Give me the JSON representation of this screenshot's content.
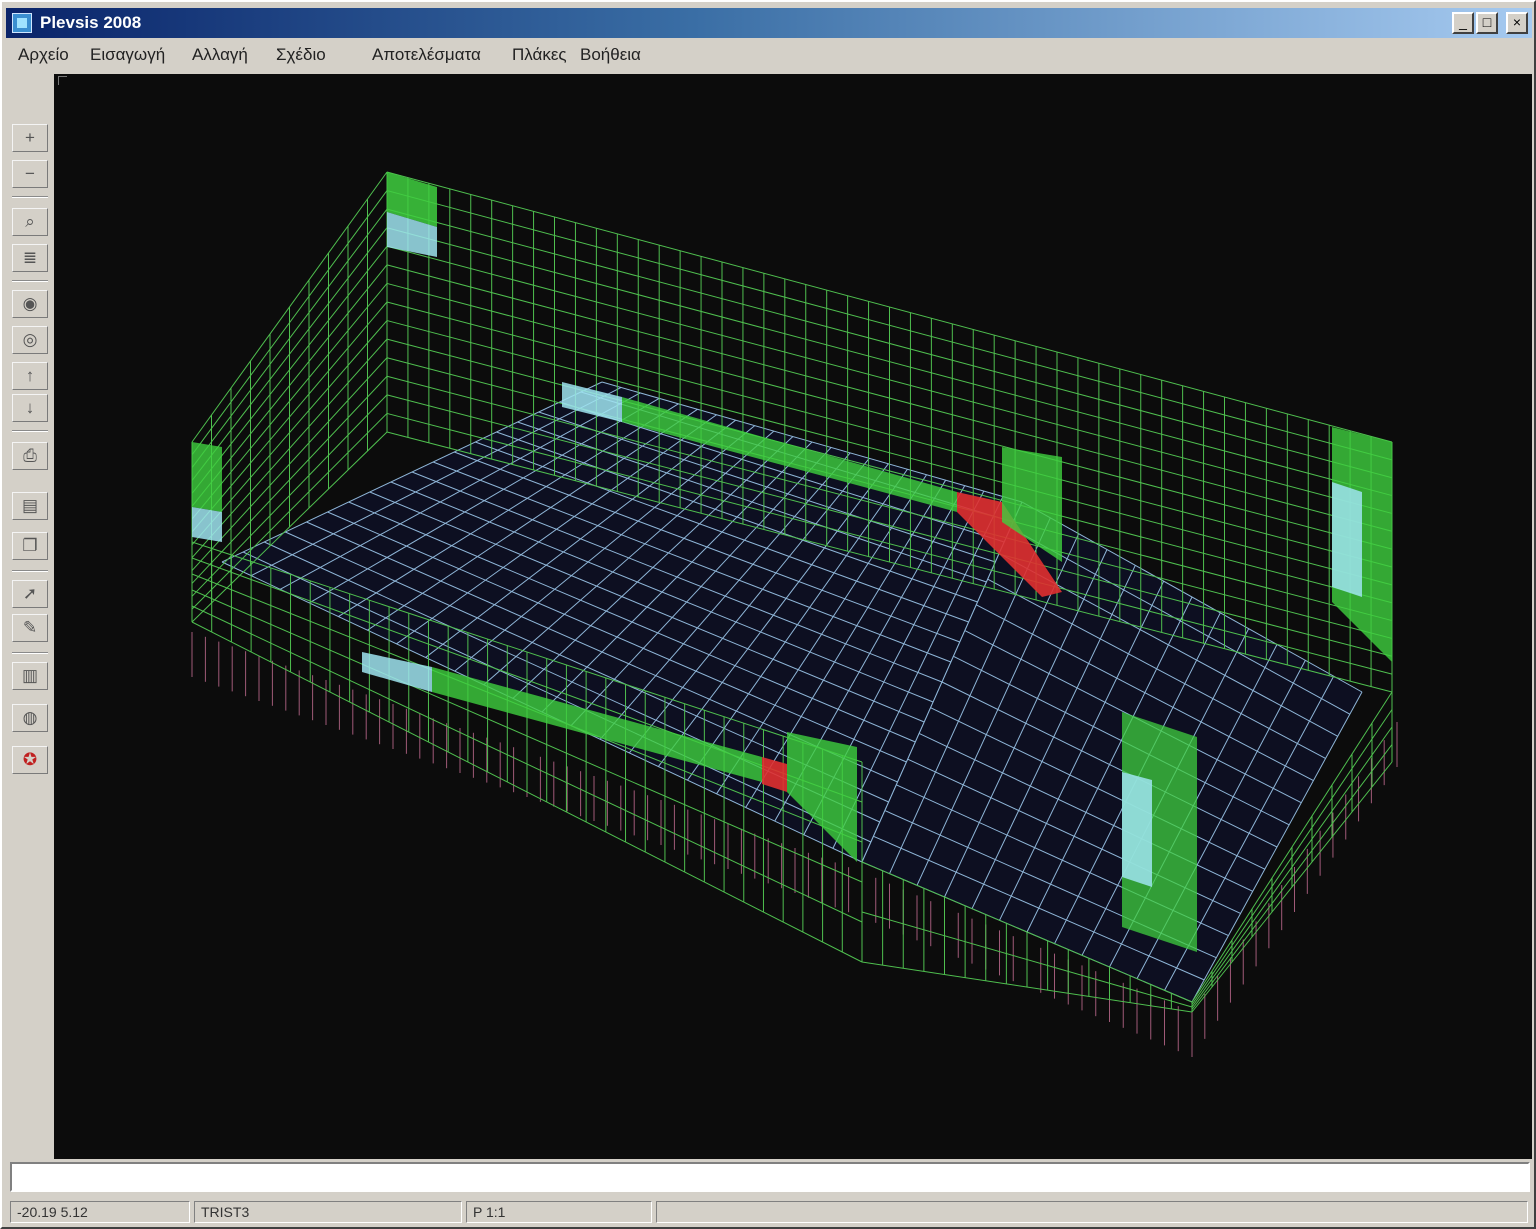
{
  "window": {
    "title": "Plevsis 2008"
  },
  "menu": [
    {
      "label": "Αρχείο"
    },
    {
      "label": "Εισαγωγή"
    },
    {
      "label": "Αλλαγή"
    },
    {
      "label": "Σχέδιο"
    },
    {
      "label": "Αποτελέσματα"
    },
    {
      "label": "Πλάκες"
    },
    {
      "label": "Βοήθεια"
    }
  ],
  "toolbar": [
    {
      "icon": "plus-icon",
      "glyph": "+"
    },
    {
      "icon": "minus-icon",
      "glyph": "−"
    },
    {
      "icon": "zoom-icon",
      "glyph": "⌕"
    },
    {
      "icon": "layers-icon",
      "glyph": "≣"
    },
    {
      "icon": "eye-icon",
      "glyph": "◉"
    },
    {
      "icon": "eye-alt-icon",
      "glyph": "◎"
    },
    {
      "icon": "move-up-icon",
      "glyph": "↑"
    },
    {
      "icon": "move-down-icon",
      "glyph": "↓"
    },
    {
      "icon": "print-icon",
      "glyph": "⎙"
    },
    {
      "icon": "save-icon",
      "glyph": "▤"
    },
    {
      "icon": "copy-icon",
      "glyph": "❐"
    },
    {
      "icon": "pointer-icon",
      "glyph": "➚"
    },
    {
      "icon": "tool-icon",
      "glyph": "✎"
    },
    {
      "icon": "chart-icon",
      "glyph": "▥"
    },
    {
      "icon": "globe-icon",
      "glyph": "◍"
    },
    {
      "icon": "help-icon",
      "glyph": "✪"
    }
  ],
  "command_line": {
    "value": ""
  },
  "status": {
    "coords": "-20.19  5.12",
    "mode": "TRIST3",
    "scale": "P 1:1"
  },
  "colors": {
    "viewport_bg": "#0c0c0c",
    "mesh_wall": "#4fbf4f",
    "mesh_floor": "#8fb6d8",
    "stress_high": "#e03030",
    "stress_mid": "#3fcf3f",
    "stress_low": "#9fe4f0",
    "supports": "#a05a78"
  }
}
